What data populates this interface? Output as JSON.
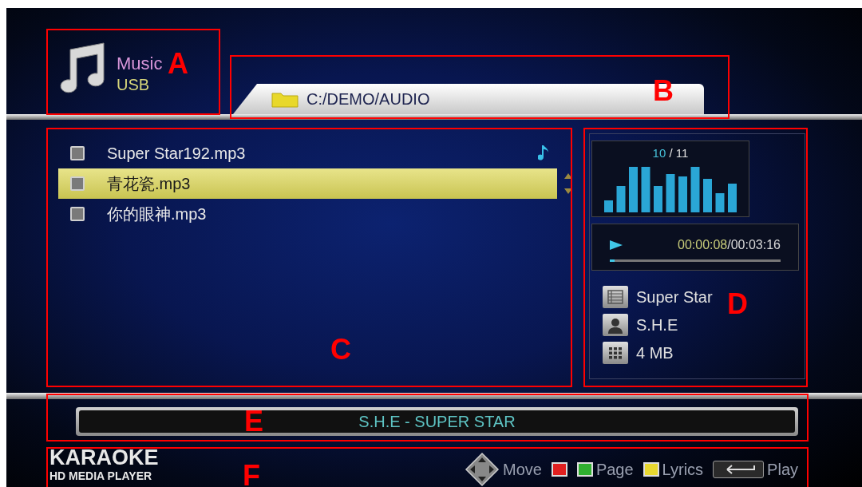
{
  "header": {
    "title": "Music",
    "source": "USB"
  },
  "path": "C:/DEMO/AUDIO",
  "files": [
    {
      "name": "Super Star192.mp3",
      "selected": false,
      "playing": true
    },
    {
      "name": "青花瓷.mp3",
      "selected": true,
      "playing": false
    },
    {
      "name": "你的眼神.mp3",
      "selected": false,
      "playing": false
    }
  ],
  "spectrum": {
    "current": "10",
    "separator": "/",
    "total": "11"
  },
  "playback": {
    "elapsed": "00:00:08",
    "separator": "/",
    "total": "00:03:16",
    "level": 0.03
  },
  "info": [
    {
      "kind": "title",
      "text": "Super Star"
    },
    {
      "kind": "artist",
      "text": "S.H.E"
    },
    {
      "kind": "size",
      "text": "4 MB"
    }
  ],
  "now_playing": "S.H.E - SUPER STAR",
  "brand": {
    "name": "KARAOKE",
    "subtitle": "HD MEDIA PLAYER"
  },
  "hints": [
    {
      "kind": "dpad",
      "label": "Move"
    },
    {
      "kind": "color",
      "color": "#e02020"
    },
    {
      "kind": "color",
      "color": "#30b030",
      "label": "Page"
    },
    {
      "kind": "color",
      "color": "#e8d830",
      "label": "Lyrics"
    },
    {
      "kind": "enter",
      "label": "Play"
    }
  ],
  "annotations": [
    "A",
    "B",
    "C",
    "D",
    "E",
    "F"
  ]
}
